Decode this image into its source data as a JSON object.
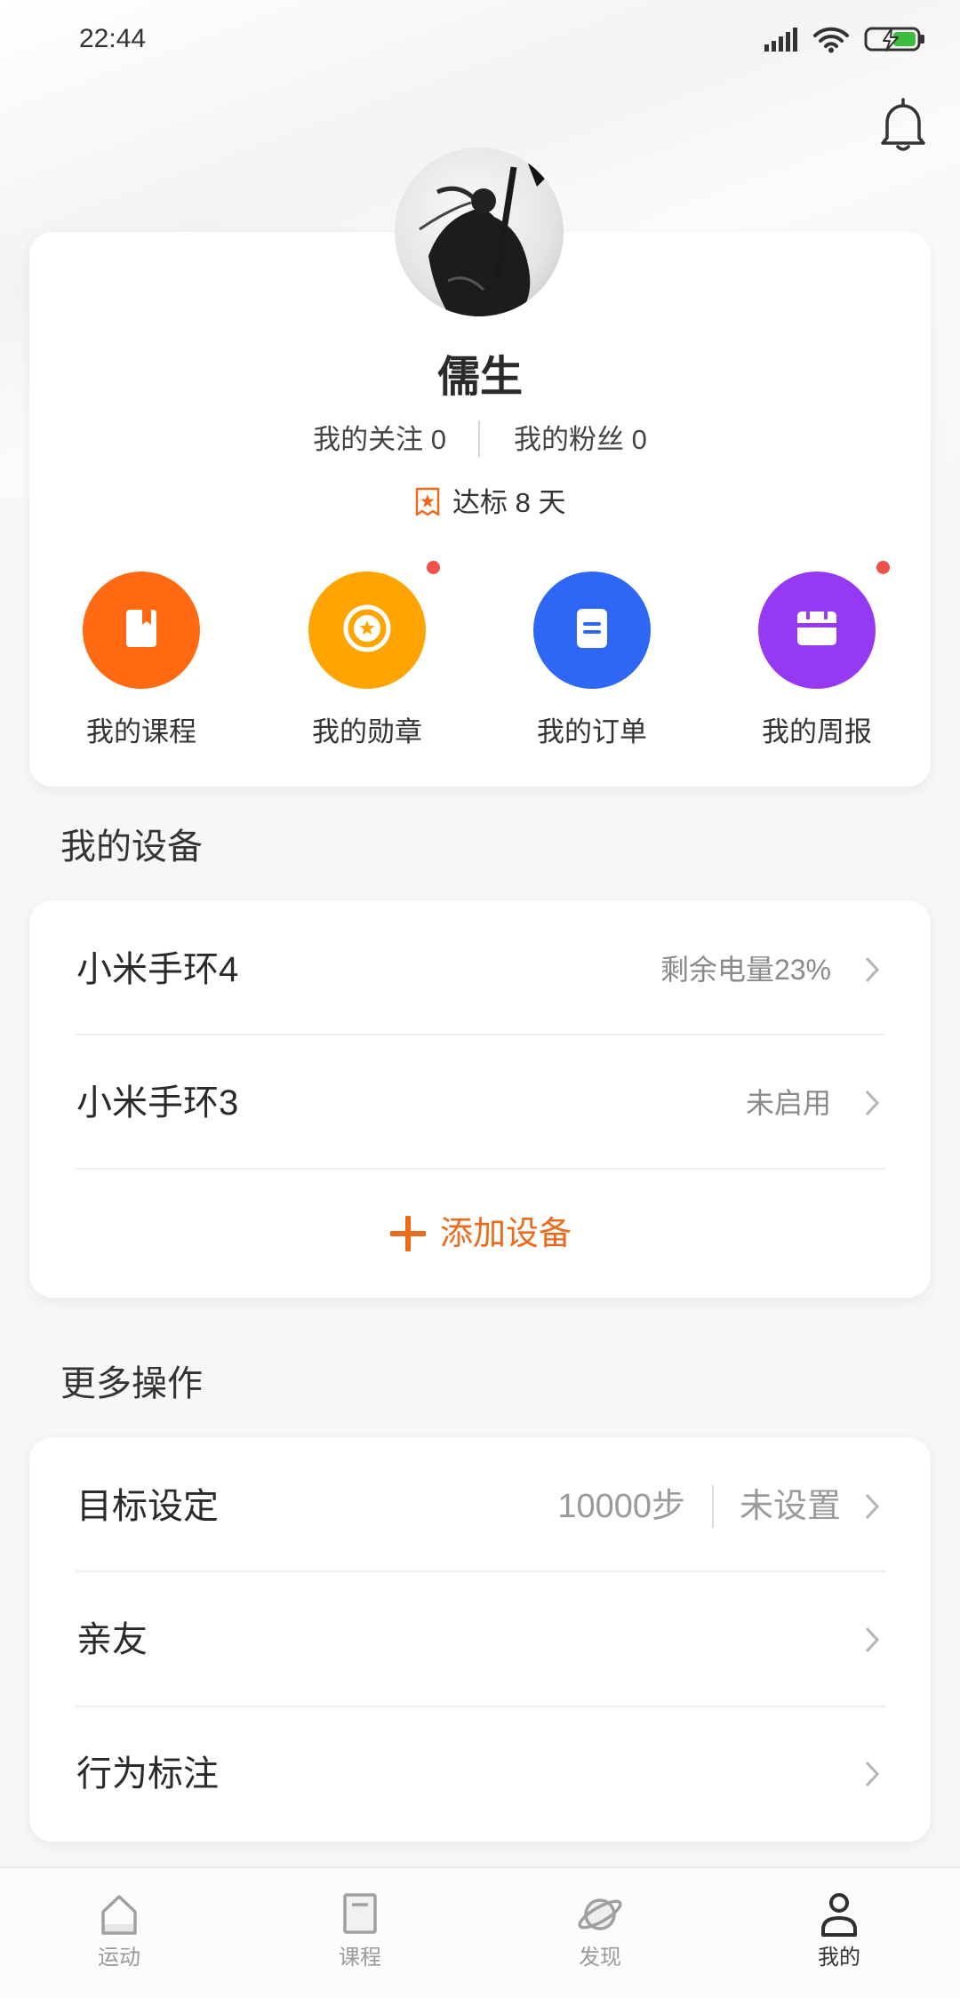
{
  "status_bar": {
    "time": "22:44",
    "icons": [
      "signal-icon",
      "wifi-icon",
      "battery-charging-icon"
    ]
  },
  "header": {
    "bell_icon": "bell-icon"
  },
  "profile": {
    "name": "儒生",
    "following": "我的关注 0",
    "followers": "我的粉丝 0",
    "streak": "达标 8 天"
  },
  "quick_actions": [
    {
      "label": "我的课程",
      "icon": "book-icon",
      "color": "#ff6a12",
      "badge": false
    },
    {
      "label": "我的勋章",
      "icon": "medal-icon",
      "color": "#ffa400",
      "badge": true
    },
    {
      "label": "我的订单",
      "icon": "document-icon",
      "color": "#2e66f6",
      "badge": false
    },
    {
      "label": "我的周报",
      "icon": "calendar-icon",
      "color": "#9539f3",
      "badge": true
    }
  ],
  "devices": {
    "title": "我的设备",
    "items": [
      {
        "name": "小米手环4",
        "status": "剩余电量23%"
      },
      {
        "name": "小米手环3",
        "status": "未启用"
      }
    ],
    "add_label": "添加设备"
  },
  "more": {
    "title": "更多操作",
    "items": [
      {
        "label": "目标设定",
        "value": "10000步",
        "status": "未设置"
      },
      {
        "label": "亲友"
      },
      {
        "label": "行为标注"
      }
    ]
  },
  "tab_bar": {
    "items": [
      {
        "label": "运动",
        "icon": "home-icon",
        "active": false
      },
      {
        "label": "课程",
        "icon": "course-icon",
        "active": false
      },
      {
        "label": "发现",
        "icon": "discover-icon",
        "active": false
      },
      {
        "label": "我的",
        "icon": "profile-icon",
        "active": true
      }
    ]
  },
  "colors": {
    "accent": "#ec6a1c",
    "badge": "#f0504a",
    "text_primary": "#333333",
    "text_secondary": "#8a8a8a",
    "background": "#f7f7f7",
    "battery_charge": "#3dbd3d"
  }
}
